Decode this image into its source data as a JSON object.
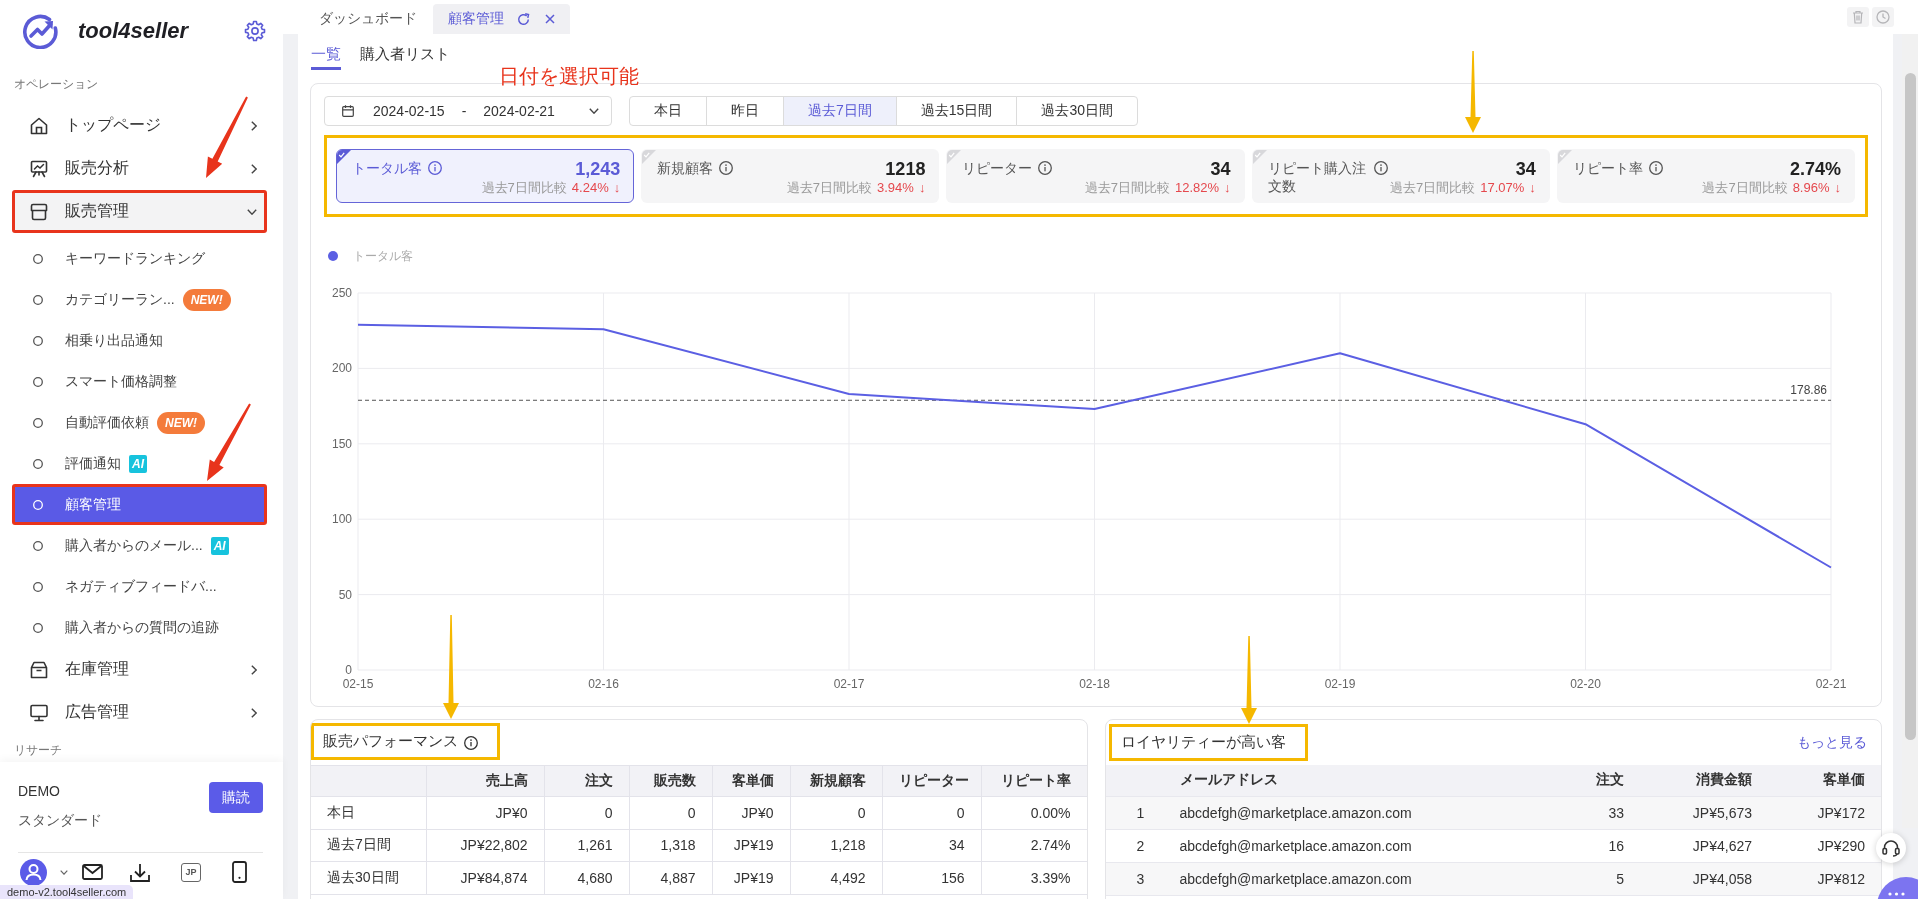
{
  "page_tabs": [
    {
      "label": "ダッシュボード",
      "selected": false
    },
    {
      "label": "顧客管理",
      "selected": true
    }
  ],
  "sidebar": {
    "logo": "tool4seller",
    "sections": [
      {
        "label": "オペレーション",
        "items": [
          {
            "label": "トップページ",
            "expanded": false,
            "selected": false,
            "highlighted": false
          },
          {
            "label": "販売分析",
            "expanded": false,
            "selected": false,
            "highlighted": false
          },
          {
            "label": "販売管理",
            "expanded": true,
            "selected": false,
            "highlighted": true,
            "children": [
              {
                "label": "キーワードランキング",
                "selected": false,
                "highlighted": false
              },
              {
                "label": "カテゴリーラン...",
                "selected": false,
                "highlighted": false,
                "badge": {
                  "kind": "new",
                  "text": "NEW!"
                }
              },
              {
                "label": "相乗り出品通知",
                "selected": false,
                "highlighted": false
              },
              {
                "label": "スマート価格調整",
                "selected": false,
                "highlighted": false
              },
              {
                "label": "自動評価依頼",
                "selected": false,
                "highlighted": false,
                "badge": {
                  "kind": "new",
                  "text": "NEW!"
                }
              },
              {
                "label": "評価通知",
                "selected": false,
                "highlighted": false,
                "badge": {
                  "kind": "ai",
                  "text": "AI"
                }
              },
              {
                "label": "顧客管理",
                "selected": true,
                "highlighted": true
              },
              {
                "label": "購入者からのメール...",
                "selected": false,
                "highlighted": false,
                "badge": {
                  "kind": "ai",
                  "text": "AI"
                }
              },
              {
                "label": "ネガティブフィードバ...",
                "selected": false,
                "highlighted": false
              },
              {
                "label": "購入者からの質問の追跡",
                "selected": false,
                "highlighted": false
              }
            ]
          },
          {
            "label": "在庫管理",
            "expanded": false,
            "selected": false,
            "highlighted": false
          },
          {
            "label": "広告管理",
            "expanded": false,
            "selected": false,
            "highlighted": false
          }
        ]
      },
      {
        "label": "リサーチ"
      }
    ],
    "account": {
      "name": "DEMO",
      "plan": "スタンダード",
      "subscribe_button": "購読"
    },
    "language": "JP",
    "status_url": "demo-v2.tool4seller.com"
  },
  "view_tabs": [
    {
      "label": "一覧",
      "selected": true
    },
    {
      "label": "購入者リスト",
      "selected": false
    }
  ],
  "annotation_note": "日付を選択可能",
  "date_range": {
    "start": "2024-02-15",
    "separator": "-",
    "end": "2024-02-21"
  },
  "periods": [
    {
      "label": "本日",
      "selected": false
    },
    {
      "label": "昨日",
      "selected": false
    },
    {
      "label": "過去7日間",
      "selected": true
    },
    {
      "label": "過去15日間",
      "selected": false
    },
    {
      "label": "過去30日間",
      "selected": false
    }
  ],
  "metrics": {
    "highlighted": true,
    "cards": [
      {
        "label": "トータル客",
        "value": "1,243",
        "compare_label": "過去7日間比較",
        "change": "4.24%",
        "trend": "↓",
        "selected": true
      },
      {
        "label": "新規顧客",
        "value": "1218",
        "compare_label": "過去7日間比較",
        "change": "3.94%",
        "trend": "↓",
        "selected": false
      },
      {
        "label": "リピーター",
        "value": "34",
        "compare_label": "過去7日間比較",
        "change": "12.82%",
        "trend": "↓",
        "selected": false
      },
      {
        "label": "リピート購入注文数",
        "value": "34",
        "compare_label": "過去7日間比較",
        "change": "17.07%",
        "trend": "↓",
        "selected": false
      },
      {
        "label": "リピート率",
        "value": "2.74%",
        "compare_label": "過去7日間比較",
        "change": "8.96%",
        "trend": "↓",
        "selected": false
      }
    ]
  },
  "chart": {
    "chart_data": {
      "type": "line",
      "categories": [
        "02-15",
        "02-16",
        "02-17",
        "02-18",
        "02-19",
        "02-20",
        "02-21"
      ],
      "series": [
        {
          "name": "トータル客",
          "color": "#5b5fe3",
          "values": [
            229,
            226,
            183,
            173,
            210,
            163,
            68
          ]
        }
      ],
      "ylim": [
        0,
        250
      ],
      "yticks": [
        0,
        50,
        100,
        150,
        200,
        250
      ],
      "grid": true,
      "ref_lines": [
        {
          "axis": "y",
          "value": 178.86,
          "label": "178.86"
        }
      ]
    }
  },
  "sales_performance": {
    "title": "販売パフォーマンス",
    "highlighted": true,
    "columns": [
      "売上高",
      "注文",
      "販売数",
      "客単価",
      "新規顧客",
      "リピーター",
      "リピート率"
    ],
    "rows": [
      {
        "label": "本日",
        "cells": [
          "JP¥0",
          "0",
          "0",
          "JP¥0",
          "0",
          "0",
          "0.00%"
        ]
      },
      {
        "label": "過去7日間",
        "cells": [
          "JP¥22,802",
          "1,261",
          "1,318",
          "JP¥19",
          "1,218",
          "34",
          "2.74%"
        ]
      },
      {
        "label": "過去30日間",
        "cells": [
          "JP¥84,874",
          "4,680",
          "4,887",
          "JP¥19",
          "4,492",
          "156",
          "3.39%"
        ]
      }
    ]
  },
  "loyal_customers": {
    "title": "ロイヤリティーが高い客",
    "highlighted": true,
    "more_link": "もっと見る",
    "columns": [
      "メールアドレス",
      "注文",
      "消費金額",
      "客単価"
    ],
    "rows": [
      {
        "rank": "1",
        "cells": [
          "abcdefgh@marketplace.amazon.com",
          "33",
          "JP¥5,673",
          "JP¥172"
        ]
      },
      {
        "rank": "2",
        "cells": [
          "abcdefgh@marketplace.amazon.com",
          "16",
          "JP¥4,627",
          "JP¥290"
        ]
      },
      {
        "rank": "3",
        "cells": [
          "abcdefgh@marketplace.amazon.com",
          "5",
          "JP¥4,058",
          "JP¥812"
        ]
      }
    ]
  }
}
